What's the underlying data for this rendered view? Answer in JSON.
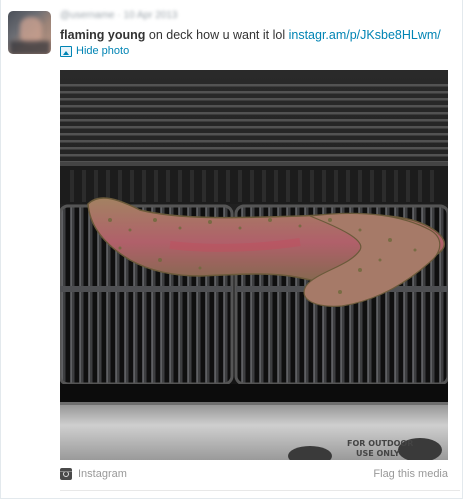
{
  "tweet": {
    "author_name": "flaming young",
    "blurred_meta": "@username · 10 Apr 2013",
    "text_before_link": "on deck how u want it lol",
    "link_text": "instagr.am/p/JKsbe8HLwm/"
  },
  "media": {
    "hide_label": "Hide photo",
    "photo_description_icon": "picture-icon",
    "grill_label_line1": "FOR OUTDOOR",
    "grill_label_line2": "USE ONLY"
  },
  "footer": {
    "source_label": "Instagram",
    "source_icon": "instagram-icon",
    "flag_label": "Flag this media"
  },
  "colors": {
    "link": "#0084b4",
    "text": "#333333",
    "muted": "#999999"
  }
}
